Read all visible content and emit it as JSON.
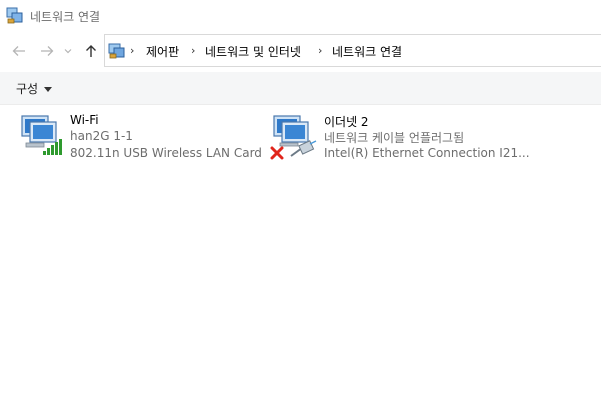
{
  "window": {
    "title": "네트워크 연결",
    "icon": "network-connections-icon"
  },
  "nav": {
    "back_icon": "back-arrow-icon",
    "forward_icon": "forward-arrow-icon",
    "recent_icon": "chevron-down-icon",
    "up_icon": "up-arrow-icon"
  },
  "address": {
    "icon": "control-panel-icon",
    "crumbs": [
      "제어판",
      "네트워크 및 인터넷",
      "네트워크 연결"
    ],
    "separator": "›"
  },
  "toolbar": {
    "organize_label": "구성"
  },
  "connections": [
    {
      "name": "Wi-Fi",
      "status": "han2G 1-1",
      "device": "802.11n USB Wireless LAN Card",
      "icon": "wifi-connection-icon",
      "signal_icon": "signal-bars-icon"
    },
    {
      "name": "이더넷 2",
      "status": "네트워크 케이블 언플러그됨",
      "device": "Intel(R) Ethernet Connection I21...",
      "icon": "ethernet-connection-icon",
      "error_icon": "disconnected-x-icon",
      "cable_icon": "ethernet-cable-icon"
    }
  ],
  "colors": {
    "error_red": "#e0251b",
    "signal_green": "#2e9a2e",
    "monitor_blue": "#2f79c9"
  }
}
